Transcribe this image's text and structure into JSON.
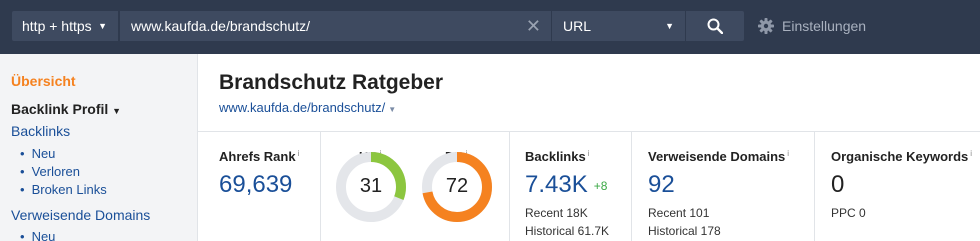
{
  "search": {
    "protocol": "http + https",
    "url": "www.kaufda.de/brandschutz/",
    "mode": "URL",
    "settings_label": "Einstellungen"
  },
  "sidebar": {
    "overview": "Übersicht",
    "backlink_profile": "Backlink Profil",
    "items": [
      {
        "label": "Backlinks"
      },
      {
        "label": "Neu"
      },
      {
        "label": "Verloren"
      },
      {
        "label": "Broken Links"
      },
      {
        "label": "Verweisende Domains"
      },
      {
        "label": "Neu"
      }
    ]
  },
  "page": {
    "title": "Brandschutz Ratgeber",
    "url": "www.kaufda.de/brandschutz/"
  },
  "metrics": {
    "ahrefs_rank": {
      "label": "Ahrefs Rank",
      "info": "i",
      "value": "69,639"
    },
    "ur": {
      "label": "UR",
      "info": "i",
      "value": "31",
      "level": 31,
      "color": "#8cc63f"
    },
    "dr": {
      "label": "DR",
      "info": "i",
      "value": "72",
      "level": 72,
      "color": "#f58220"
    },
    "backlinks": {
      "label": "Backlinks",
      "info": "i",
      "value": "7.43K",
      "delta": "+8",
      "recent": "Recent 18K",
      "historical": "Historical 61.7K"
    },
    "ref_domains": {
      "label": "Verweisende Domains",
      "info": "i",
      "value": "92",
      "recent": "Recent 101",
      "historical": "Historical 178"
    },
    "organic_keywords": {
      "label": "Organische Keywords",
      "info": "i",
      "value": "0",
      "ppc": "PPC 0"
    }
  },
  "colors": {
    "topbar": "#2f3a4e",
    "accent_orange": "#f58220",
    "link_blue": "#1a4f98",
    "gauge_track": "#e4e6ea",
    "positive_green": "#3aa844"
  },
  "icons": {
    "clear": "close-icon",
    "search": "search-icon",
    "settings": "gear-icon"
  }
}
